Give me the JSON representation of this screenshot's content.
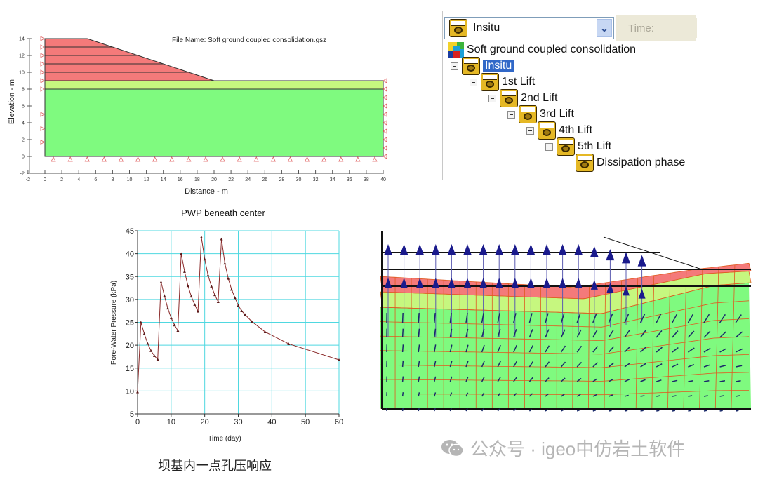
{
  "geometry_plot": {
    "file_name_label": "File Name: Soft ground coupled consolidation.gsz",
    "xlabel": "Distance - m",
    "ylabel": "Elevation - m",
    "xlim": [
      -2,
      40
    ],
    "ylim": [
      -2,
      14
    ],
    "x_ticks": [
      "-2",
      "0",
      "2",
      "4",
      "6",
      "8",
      "10",
      "12",
      "14",
      "16",
      "18",
      "20",
      "22",
      "24",
      "26",
      "28",
      "30",
      "32",
      "34",
      "36",
      "38",
      "40"
    ],
    "y_ticks": [
      "-2",
      "0",
      "2",
      "4",
      "6",
      "8",
      "10",
      "12",
      "14"
    ],
    "embankment_lift_elevations": [
      9,
      10,
      11,
      12,
      13,
      14
    ],
    "embankment_crest": {
      "x_from": 0,
      "x_to": 5,
      "elevation": 14
    },
    "embankment_toe": {
      "x": 20,
      "elevation": 9
    },
    "layers": [
      {
        "name": "embankment",
        "color": "#f47a7a",
        "top": 14,
        "bottom": 9
      },
      {
        "name": "upper-soil",
        "color": "#c6f77f",
        "top": 9,
        "bottom": 8
      },
      {
        "name": "soft-clay",
        "color": "#7ffa7f",
        "top": 8,
        "bottom": 0
      }
    ],
    "boundary_color": "#e06060"
  },
  "stage_panel": {
    "selected_stage": "Insitu",
    "time_label": "Time:",
    "tree": [
      {
        "label": "Soft ground coupled consolidation",
        "level": 0,
        "type": "project",
        "expandable": false
      },
      {
        "label": "Insitu",
        "level": 1,
        "type": "stage",
        "expandable": true,
        "selected": true
      },
      {
        "label": "1st Lift",
        "level": 2,
        "type": "stage",
        "expandable": true
      },
      {
        "label": "2nd Lift",
        "level": 3,
        "type": "stage",
        "expandable": true
      },
      {
        "label": "3rd Lift",
        "level": 4,
        "type": "stage",
        "expandable": true
      },
      {
        "label": "4th Lift",
        "level": 5,
        "type": "stage",
        "expandable": true
      },
      {
        "label": "5th Lift",
        "level": 6,
        "type": "stage",
        "expandable": true
      },
      {
        "label": "Dissipation  phase",
        "level": 7,
        "type": "stage",
        "expandable": false
      }
    ],
    "selection_color": "#3168c8"
  },
  "chart_data": {
    "type": "line",
    "title": "PWP beneath center",
    "xlabel": "Time (day)",
    "ylabel": "Pore-Water Pressure (kPa)",
    "xlim": [
      0,
      60
    ],
    "ylim": [
      5,
      45
    ],
    "x_ticks": [
      0,
      10,
      20,
      30,
      40,
      50,
      60
    ],
    "y_ticks": [
      5,
      10,
      15,
      20,
      25,
      30,
      35,
      40,
      45
    ],
    "grid": true,
    "grid_color": "#4fd8e0",
    "line_color": "#8b2a2a",
    "series": [
      {
        "name": "PWP",
        "x": [
          0,
          1,
          2,
          3,
          4,
          5,
          6,
          7,
          8,
          9,
          10,
          11,
          12,
          13,
          14,
          15,
          16,
          17,
          18,
          19,
          20,
          21,
          22,
          23,
          24,
          25,
          26,
          27,
          28,
          29,
          30,
          31,
          32,
          34,
          38,
          45,
          60
        ],
        "y": [
          9.8,
          25.0,
          22.5,
          20.4,
          18.8,
          17.7,
          16.9,
          33.8,
          30.8,
          28.1,
          26.0,
          24.4,
          23.2,
          40.0,
          36.1,
          33.0,
          30.7,
          28.9,
          27.4,
          43.6,
          38.8,
          35.3,
          32.9,
          31.0,
          29.5,
          43.2,
          37.9,
          34.6,
          32.2,
          30.4,
          28.7,
          27.5,
          26.7,
          25.2,
          22.9,
          20.3,
          16.8
        ]
      }
    ]
  },
  "deformation_plot": {
    "arrow_color": "#1a1a8c",
    "mesh_color": "#e05a20",
    "layer_colors": {
      "embankment": "#f47a7a",
      "upper-soil": "#c6f77f",
      "soft-clay": "#7ffa7f"
    }
  },
  "caption": "坝基内一点孔压响应",
  "watermark": "公众号 · igeo中仿岩土软件"
}
